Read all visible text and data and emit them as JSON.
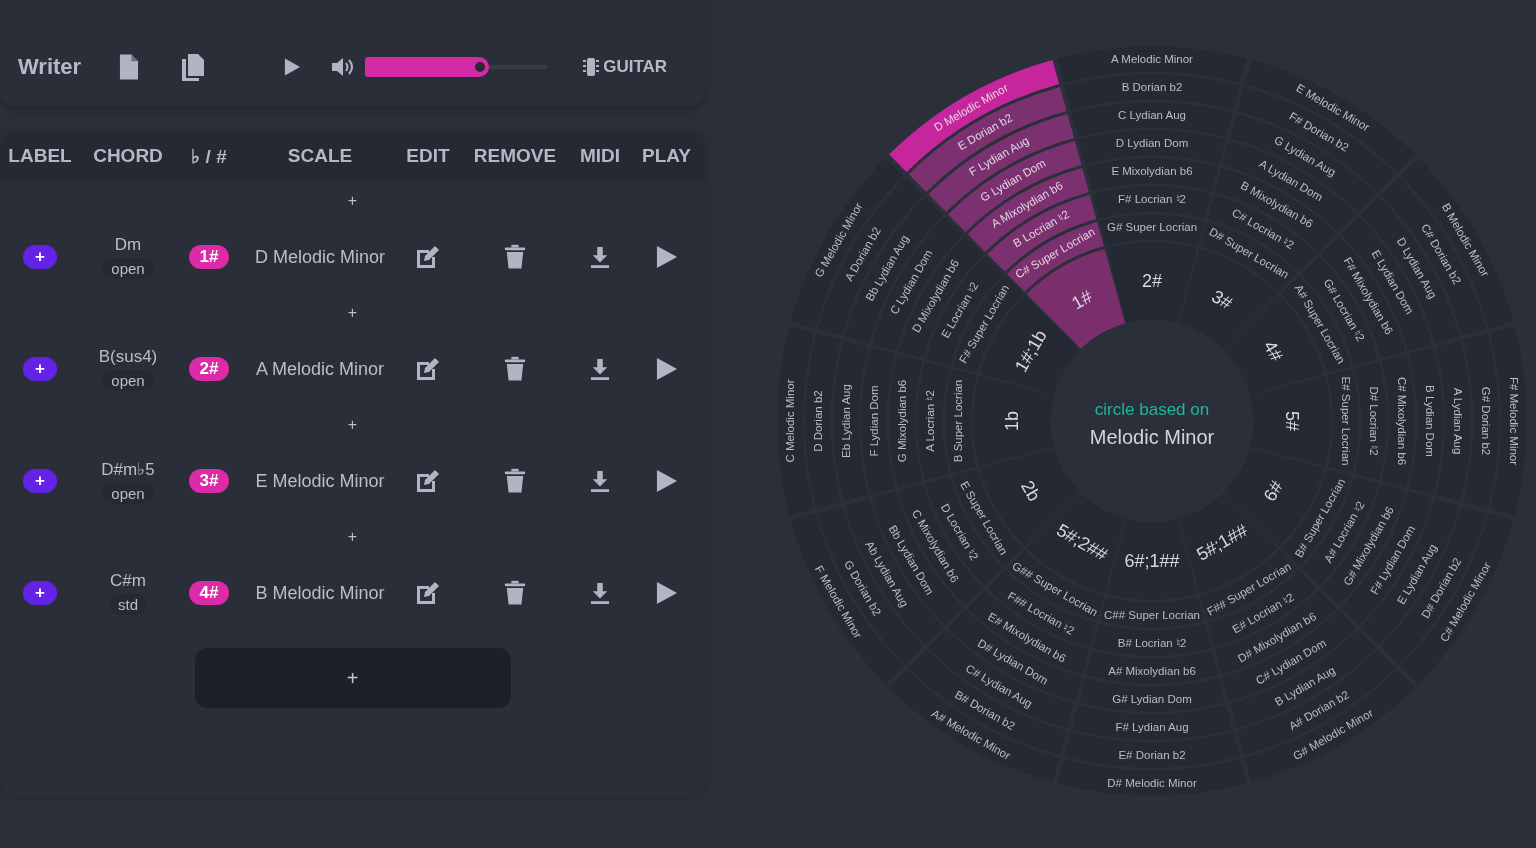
{
  "toolbar": {
    "title": "Writer",
    "volume": {
      "level": 0.68
    },
    "instrument": "GUITAR"
  },
  "table": {
    "columns": [
      "LABEL",
      "CHORD",
      "♭ / #",
      "SCALE",
      "EDIT",
      "REMOVE",
      "MIDI",
      "PLAY"
    ],
    "rows": [
      {
        "kind": "insert",
        "label": "+"
      },
      {
        "kind": "chord",
        "add": "+",
        "chord": "Dm",
        "voicing": "open",
        "accidentals": "1#",
        "scale": "D Melodic Minor"
      },
      {
        "kind": "insert",
        "label": "+"
      },
      {
        "kind": "chord",
        "add": "+",
        "chord": "B(sus4)",
        "voicing": "open",
        "accidentals": "2#",
        "scale": "A Melodic Minor"
      },
      {
        "kind": "insert",
        "label": "+"
      },
      {
        "kind": "chord",
        "add": "+",
        "chord": "D#m♭5",
        "voicing": "open",
        "accidentals": "3#",
        "scale": "E Melodic Minor"
      },
      {
        "kind": "insert",
        "label": "+"
      },
      {
        "kind": "chord",
        "add": "+",
        "chord": "C#m",
        "voicing": "std",
        "accidentals": "4#",
        "scale": "B Melodic Minor"
      }
    ],
    "add_button": "+"
  },
  "circle": {
    "caption": "circle based on",
    "title": "Melodic Minor",
    "sectors": [
      {
        "label": "2#",
        "selected": false,
        "modes": [
          "A Melodic Minor",
          "B Dorian b2",
          "C Lydian Aug",
          "D Lydian Dom",
          "E Mixolydian b6",
          "F# Locrian ♮2",
          "G# Super Locrian"
        ]
      },
      {
        "label": "3#",
        "selected": false,
        "modes": [
          "E Melodic Minor",
          "F# Dorian b2",
          "G Lydian Aug",
          "A Lydian Dom",
          "B Mixolydian b6",
          "C# Locrian ♮2",
          "D# Super Locrian"
        ]
      },
      {
        "label": "4#",
        "selected": false,
        "modes": [
          "B Melodic Minor",
          "C# Dorian b2",
          "D Lydian Aug",
          "E Lydian Dom",
          "F# Mixolydian b6",
          "G# Locrian ♮2",
          "A# Super Locrian"
        ]
      },
      {
        "label": "5#",
        "selected": false,
        "modes": [
          "E# Super Locrian",
          "D# Locrian ♮2",
          "C# Mixolydian b6",
          "B Lydian Dom",
          "A Lydian Aug",
          "G# Dorian b2",
          "F# Melodic Minor"
        ]
      },
      {
        "label": "6#",
        "selected": false,
        "modes": [
          "B# Super Locrian",
          "A# Locrian ♮2",
          "G# Mixolydian b6",
          "F# Lydian Dom",
          "E Lydian Aug",
          "D# Dorian b2",
          "C# Melodic Minor"
        ]
      },
      {
        "label": "5#;1##",
        "selected": false,
        "modes": [
          "F## Super Locrian",
          "E# Locrian ♮2",
          "D# Mixolydian b6",
          "C# Lydian Dom",
          "B Lydian Aug",
          "A# Dorian b2",
          "G# Melodic Minor"
        ]
      },
      {
        "label": "6#;1##",
        "selected": false,
        "modes": [
          "C## Super Locrian",
          "B# Locrian ♮2",
          "A# Mixolydian b6",
          "G# Lydian Dom",
          "F# Lydian Aug",
          "E# Dorian b2",
          "D# Melodic Minor"
        ]
      },
      {
        "label": "5#;2##",
        "selected": false,
        "modes": [
          "G## Super Locrian",
          "F## Locrian ♮2",
          "E# Mixolydian b6",
          "D# Lydian Dom",
          "C# Lydian Aug",
          "B# Dorian b2",
          "A# Melodic Minor"
        ]
      },
      {
        "label": "2b",
        "selected": false,
        "modes": [
          "E Super Locrian",
          "D Locrian ♮2",
          "C Mixolydian b6",
          "Bb Lydian Dom",
          "Ab Lydian Aug",
          "G Dorian b2",
          "F Melodic Minor"
        ]
      },
      {
        "label": "1b",
        "selected": false,
        "modes": [
          "C Melodic Minor",
          "D Dorian b2",
          "Eb Lydian Aug",
          "F Lydian Dom",
          "G Mixolydian b6",
          "A Locrian ♮2",
          "B Super Locrian"
        ]
      },
      {
        "label": "1#;1b",
        "selected": false,
        "modes": [
          "G Melodic Minor",
          "A Dorian b2",
          "Bb Lydian Aug",
          "C Lydian Dom",
          "D Mixolydian b6",
          "E Locrian ♮2",
          "F# Super Locrian"
        ]
      },
      {
        "label": "1#",
        "selected": true,
        "modes": [
          "D Melodic Minor",
          "E Dorian b2",
          "F Lydian Aug",
          "G Lydian Dom",
          "A Mixolydian b6",
          "B Locrian ♮2",
          "C# Super Locrian"
        ]
      }
    ]
  }
}
